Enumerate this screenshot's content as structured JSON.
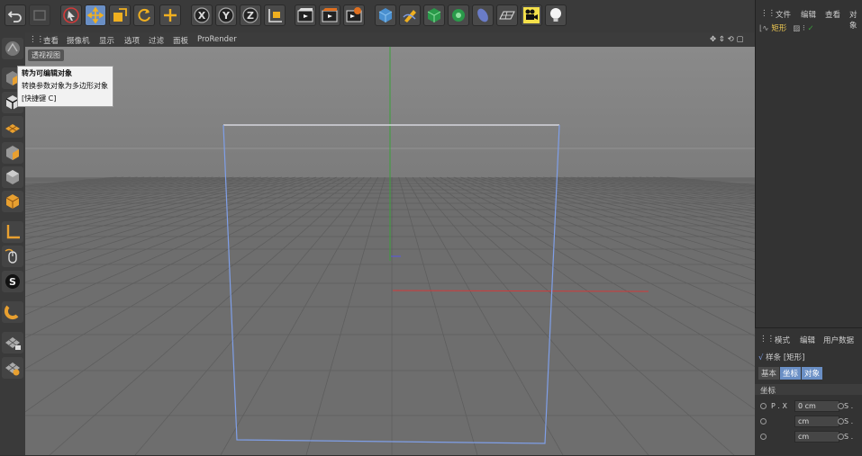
{
  "viewport": {
    "menu": [
      "查看",
      "摄像机",
      "显示",
      "选项",
      "过滤",
      "面板",
      "ProRender"
    ],
    "label": "透视视图"
  },
  "tooltip": {
    "title": "转为可编辑对象",
    "description": "转换参数对象为多边形对象",
    "shortcut": "[快捷键 C]"
  },
  "object_manager": {
    "menu": [
      "文件",
      "编辑",
      "查看",
      "对象"
    ],
    "object_name": "矩形"
  },
  "attribute_manager": {
    "menu": [
      "模式",
      "编辑",
      "用户数据"
    ],
    "title": "样条 [矩形]",
    "tabs": [
      "基本",
      "坐标",
      "对象"
    ],
    "section": "坐标",
    "coords": [
      {
        "label": "P . X",
        "value": "0 cm",
        "s": "S ."
      },
      {
        "label": "",
        "value": "cm",
        "s": "S ."
      },
      {
        "label": "",
        "value": "cm",
        "s": "S ."
      }
    ]
  },
  "colors": {
    "accent": "#6a8fc5",
    "object_highlight": "#e8c350",
    "axis_x": "#d23a3a",
    "axis_y": "#3aa03a",
    "spline": "#7f9fe8"
  },
  "icons": {
    "toolbar": [
      "undo-icon",
      "redo-icon",
      "live-selection-icon",
      "move-icon",
      "scale-icon",
      "rotate-icon",
      "add-icon",
      "x-axis-icon",
      "y-axis-icon",
      "z-axis-icon",
      "coordinate-system-icon",
      "render-view-icon",
      "render-picture-viewer-icon",
      "render-settings-icon",
      "cube-icon",
      "pen-icon",
      "subdivision-icon",
      "cloner-icon",
      "deformer-icon",
      "floor-icon",
      "camera-icon",
      "light-icon"
    ],
    "left": [
      "make-editable-icon",
      "texture-mode-icon",
      "model-mode-icon",
      "points-mode-icon",
      "edges-mode-icon",
      "polygons-mode-icon",
      "axis-mode-icon",
      "tweak-mode-icon",
      "snap-icon",
      "magnet-icon",
      "workplane-lock-icon",
      "workplane-icon"
    ]
  }
}
